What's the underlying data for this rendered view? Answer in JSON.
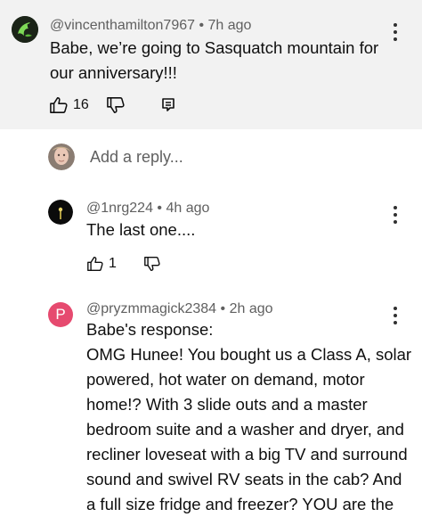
{
  "comments": [
    {
      "handle": "@vincenthamilton7967",
      "time": "7h ago",
      "text": "Babe, we’re going to Sasquatch mountain for our anniversary!!!",
      "likes": "16",
      "avatar_icon": "green-dragon-avatar"
    }
  ],
  "reply_box": {
    "placeholder": "Add a reply..."
  },
  "replies": [
    {
      "handle": "@1nrg224",
      "time": "4h ago",
      "text": "The last one....",
      "likes": "1",
      "avatar_icon": "dark-photo-avatar"
    },
    {
      "handle": "@pryzmmagick2384",
      "time": "2h ago",
      "avatar_letter": "P",
      "avatar_color": "#e64a6f",
      "lines": [
        "Babe's response:",
        "OMG Hunee! You bought us a Class A, solar",
        "powered, hot water on demand,  motor",
        "home!? With 3 slide outs and a master",
        "bedroom suite and a washer and dryer, and",
        "recliner loveseat with a big TV and surround",
        "sound and swivel RV seats in the cab?  And",
        "a full size fridge and freezer? YOU are the"
      ]
    }
  ],
  "separator": " • "
}
